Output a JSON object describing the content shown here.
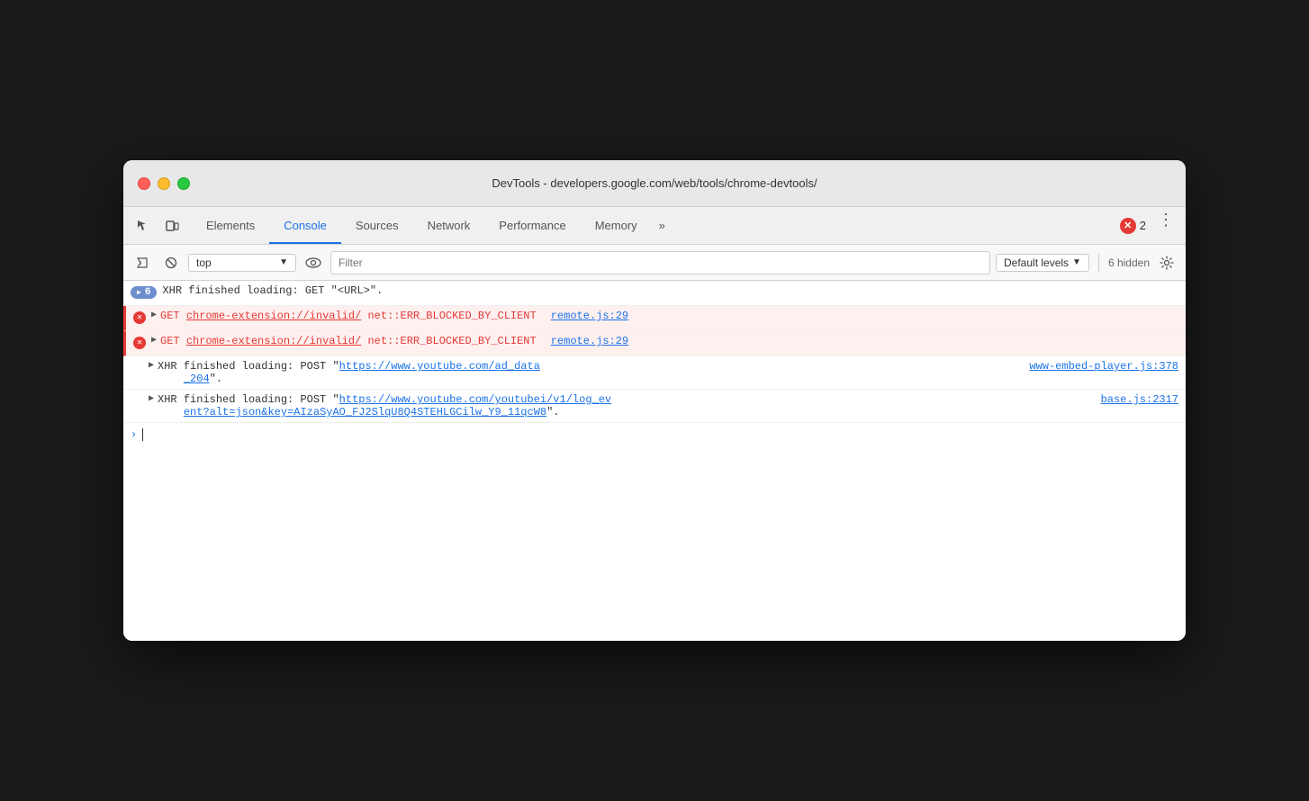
{
  "window": {
    "title": "DevTools - developers.google.com/web/tools/chrome-devtools/"
  },
  "tabs": [
    {
      "id": "elements",
      "label": "Elements",
      "active": false
    },
    {
      "id": "console",
      "label": "Console",
      "active": true
    },
    {
      "id": "sources",
      "label": "Sources",
      "active": false
    },
    {
      "id": "network",
      "label": "Network",
      "active": false
    },
    {
      "id": "performance",
      "label": "Performance",
      "active": false
    },
    {
      "id": "memory",
      "label": "Memory",
      "active": false
    }
  ],
  "toolbar": {
    "context_value": "top",
    "context_placeholder": "top",
    "filter_placeholder": "Filter",
    "levels_label": "Default levels",
    "hidden_label": "6 hidden"
  },
  "error_badge": {
    "count": "2"
  },
  "console_entries": [
    {
      "type": "info",
      "badge": "6",
      "text": "XHR finished loading: GET \"<URL>\".",
      "source": null
    },
    {
      "type": "error",
      "method": "GET",
      "url": "chrome-extension://invalid/",
      "error": "net::ERR_BLOCKED_BY_CLIENT",
      "source": "remote.js:29"
    },
    {
      "type": "error",
      "method": "GET",
      "url": "chrome-extension://invalid/",
      "error": "net::ERR_BLOCKED_BY_CLIENT",
      "source": "remote.js:29"
    },
    {
      "type": "log",
      "text": "XHR finished loading: POST \"https://www.youtube.com/ad_data",
      "text2": "_204\".",
      "source": "www-embed-player.js:378"
    },
    {
      "type": "log",
      "text": "XHR finished loading: POST \"https://www.youtube.com/youtubei/v1/log_ev",
      "text2": "ent?alt=json&key=AIzaSyAO_FJ2SlqU8Q4STEHLGCilw_Y9_11qcW8\".",
      "source": "base.js:2317"
    }
  ]
}
